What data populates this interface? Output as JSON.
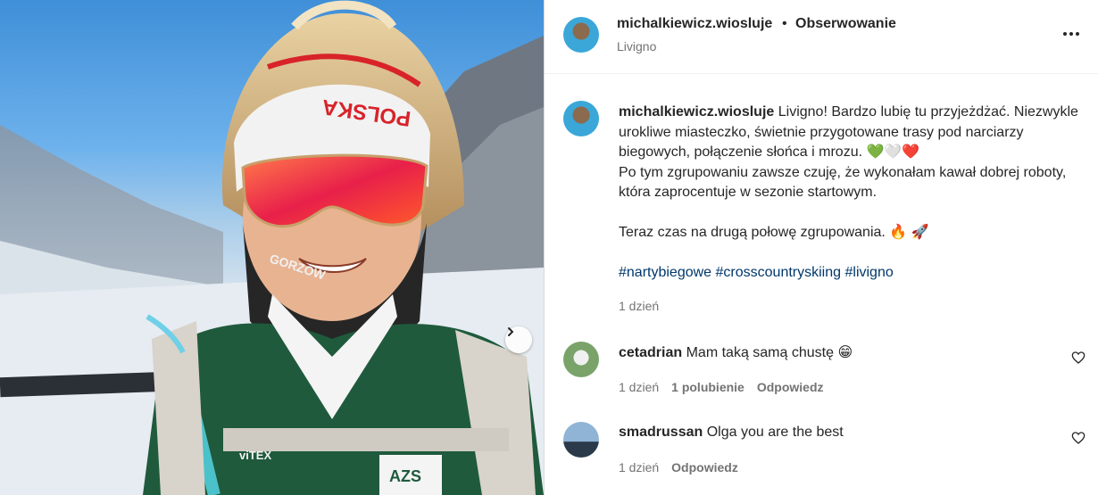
{
  "header": {
    "username": "michalkiewicz.wiosluje",
    "separator": "•",
    "follow_label": "Obserwowanie",
    "location": "Livigno"
  },
  "caption": {
    "username": "michalkiewicz.wiosluje",
    "line1": "Livigno! Bardzo lubię tu przyjeżdżać. Niezwykle urokliwe miasteczko, świetnie przygotowane trasy pod narciarzy biegowych, połączenie słońca i mrozu.",
    "line2": "Po tym zgrupowaniu zawsze czuję, że wykonałam kawał dobrej roboty, która zaprocentuje w sezonie startowym.",
    "line3": "Teraz czas na drugą połowę zgrupowania.",
    "hashtags": [
      "#nartybiegowe",
      "#crosscountryskiing",
      "#livigno"
    ],
    "time": "1 dzień"
  },
  "comments": [
    {
      "username": "cetadrian",
      "text": "Mam taką samą chustę",
      "emoji": "😁",
      "time": "1 dzień",
      "likes": "1 polubienie",
      "reply_label": "Odpowiedz"
    },
    {
      "username": "smadrussan",
      "text": "Olga you are the best",
      "time": "1 dzień",
      "reply_label": "Odpowiedz"
    }
  ],
  "photo": {
    "headband_text": "POLSKA",
    "neck_text": "GORZÓW",
    "vest_logo": "AZS",
    "brand": "viTEX"
  },
  "icons": {
    "next": "chevron-right-icon",
    "more": "more-options-icon",
    "like": "heart-outline-icon",
    "fire": "🔥",
    "rocket": "🚀",
    "hearts": [
      "💚",
      "🤍",
      "❤️"
    ]
  },
  "colors": {
    "link": "#00376b",
    "secondary_text": "#737373",
    "border": "#dbdbdb"
  }
}
